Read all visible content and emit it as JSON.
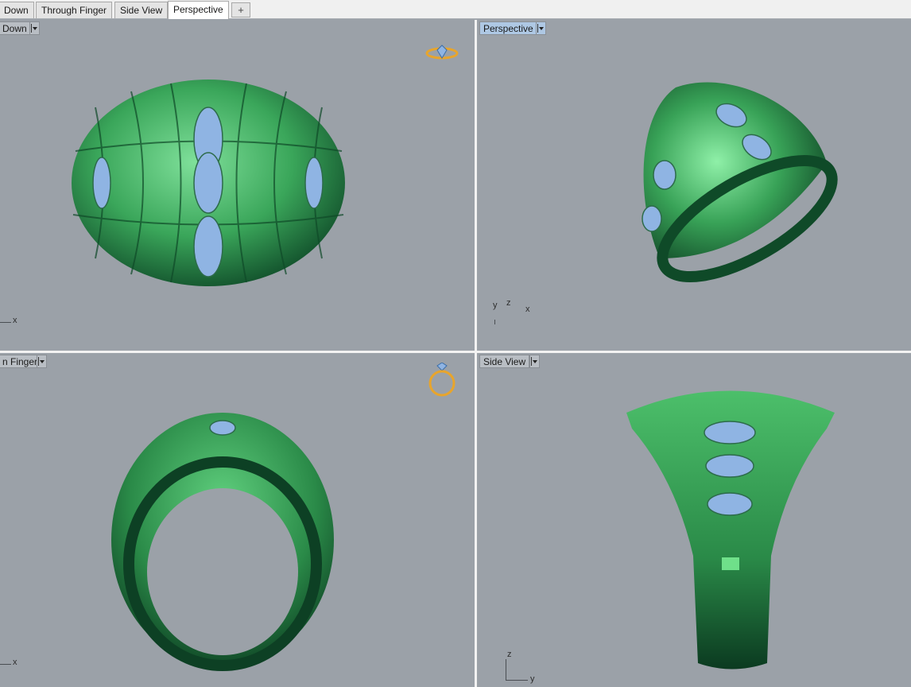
{
  "tabs": [
    {
      "label": "Down"
    },
    {
      "label": "Through Finger"
    },
    {
      "label": "Side View"
    },
    {
      "label": "Perspective"
    }
  ],
  "tab_add_label": "+",
  "viewports": {
    "top_left": {
      "label": "Down",
      "axis": "x"
    },
    "top_right": {
      "label": "Perspective",
      "axis_y": "y",
      "axis_z": "z",
      "axis_x": "x"
    },
    "bottom_left": {
      "label": "n Finger",
      "axis": "x"
    },
    "bottom_right": {
      "label": "Side View",
      "axis_z": "z",
      "axis_y": "y"
    }
  },
  "colors": {
    "viewport_bg": "#9ba1a8",
    "metal": "#3a9a55",
    "metal_dark": "#145a32",
    "stone": "#8fb4e3",
    "widget": "#e8a52c"
  }
}
